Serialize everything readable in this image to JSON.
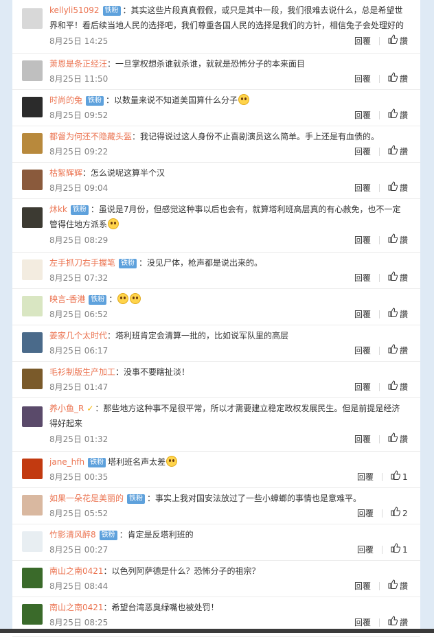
{
  "labels": {
    "reply": "回覆",
    "like": "讚"
  },
  "comments": [
    {
      "name": "kellyli51092",
      "badge": "铁粉",
      "vip": false,
      "text": "：其实这些片段真真假假，或只是其中一段，我们很难去说什么，总是希望世界和平！看后续当地人民的选择吧，我们尊重各国人民的选择是我们的方针，相信兔子会处理好的",
      "emoji": "",
      "time": "8月25日 14:25",
      "likes": "",
      "avatar_color": "#d8d8d8"
    },
    {
      "name": "萧恩是条正经汪",
      "badge": "",
      "vip": false,
      "text": "：一旦掌权想杀谁就杀谁，就就是恐怖分子的本来面目",
      "emoji": "",
      "time": "8月25日 11:50",
      "likes": "",
      "avatar_color": "#bfbfbf"
    },
    {
      "name": "时尚的兔",
      "badge": "铁粉",
      "vip": false,
      "text": "：以数量来说不知道美国算什么分子",
      "emoji": "1",
      "time": "8月25日 09:52",
      "likes": "",
      "avatar_color": "#2b2b2b"
    },
    {
      "name": "都督为何还不隐藏头盔",
      "badge": "",
      "vip": false,
      "text": "：我记得说过这人身份不止喜剧演员这么简单。手上还是有血债的。",
      "emoji": "",
      "time": "8月25日 09:22",
      "likes": "",
      "avatar_color": "#b8893c"
    },
    {
      "name": "枯絮辉辉",
      "badge": "",
      "vip": false,
      "text": "：怎么说呢这算半个汉",
      "emoji": "",
      "time": "8月25日 09:04",
      "likes": "",
      "avatar_color": "#8a5a3c"
    },
    {
      "name": "炑kk",
      "badge": "铁粉",
      "vip": false,
      "text": "：虽说是7月份，但感觉这种事以后也会有，就算塔利班高层真的有心赦免，也不一定管得住地方派系",
      "emoji": "1",
      "time": "8月25日 08:29",
      "likes": "",
      "avatar_color": "#3c3a32"
    },
    {
      "name": "左手抓刀右手握笔",
      "badge": "铁粉",
      "vip": false,
      "text": "：没见尸体，枪声都是说出来的。",
      "emoji": "",
      "time": "8月25日 07:32",
      "likes": "",
      "avatar_color": "#f3ece0"
    },
    {
      "name": "映言-香港",
      "badge": "铁粉",
      "vip": false,
      "text": "：",
      "emoji": "2",
      "time": "8月25日 06:52",
      "likes": "",
      "avatar_color": "#d9e6c2"
    },
    {
      "name": "姜家几个太时代",
      "badge": "",
      "vip": false,
      "text": "：塔利班肯定会清算一批的，比如说军队里的高层",
      "emoji": "",
      "time": "8月25日 06:17",
      "likes": "",
      "avatar_color": "#4a6a8a"
    },
    {
      "name": "毛衫制版生产加工",
      "badge": "",
      "vip": false,
      "text": "：没事不要瞎扯淡！",
      "emoji": "",
      "time": "8月25日 01:47",
      "likes": "",
      "avatar_color": "#7a5a2a"
    },
    {
      "name": "养小鱼_R",
      "badge": "",
      "vip": true,
      "text": "：那些地方这种事不是很平常，所以才需要建立稳定政权发展民生。但是前提是经济得好起来",
      "emoji": "",
      "time": "8月25日 01:32",
      "likes": "",
      "avatar_color": "#5a4a6a"
    },
    {
      "name": "jane_hfh",
      "badge": "铁粉",
      "vip": false,
      "text": "塔利班名声太差",
      "emoji": "1",
      "time": "8月25日 00:35",
      "likes": "1",
      "avatar_color": "#c23a10"
    },
    {
      "name": "如果一朵花是美丽的",
      "badge": "铁粉",
      "vip": false,
      "text": "：事实上我对国安法放过了一些小蟑螂的事情也是意难平。",
      "emoji": "",
      "time": "8月25日 05:52",
      "likes": "2",
      "avatar_color": "#d9b8a0"
    },
    {
      "name": "竹影清风醉8",
      "badge": "铁粉",
      "vip": false,
      "text": "：肯定是反塔利班的",
      "emoji": "",
      "time": "8月25日 00:27",
      "likes": "1",
      "avatar_color": "#e8eef2"
    },
    {
      "name": "南山之南0421",
      "badge": "",
      "vip": false,
      "text": "：以色列阿萨德是什么？恐怖分子的祖宗？",
      "emoji": "",
      "time": "8月25日 08:44",
      "likes": "",
      "avatar_color": "#3a6a2a"
    },
    {
      "name": "南山之南0421",
      "badge": "",
      "vip": false,
      "text": "：希望台湾恶臭绿嘴也被处罚！",
      "emoji": "",
      "time": "8月25日 08:25",
      "likes": "",
      "avatar_color": "#3a6a2a"
    }
  ]
}
